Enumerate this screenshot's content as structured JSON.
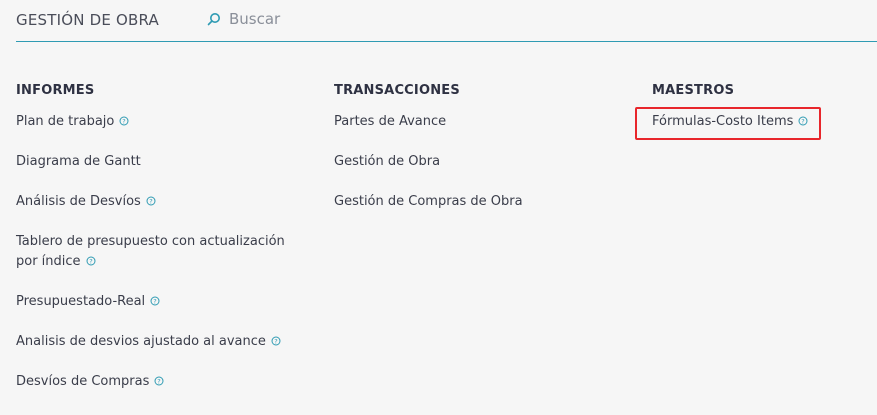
{
  "header": {
    "title": "GESTIÓN DE OBRA",
    "search_placeholder": "Buscar"
  },
  "sections": {
    "informes": {
      "title": "INFORMES",
      "items": [
        {
          "label": "Plan de trabajo",
          "help": true
        },
        {
          "label": "Diagrama de Gantt",
          "help": false
        },
        {
          "label": "Análisis de Desvíos",
          "help": true
        },
        {
          "label_line1": "Tablero de presupuesto con actualización",
          "label_line2": "por índice",
          "help": true
        },
        {
          "label": "Presupuestado-Real",
          "help": true
        },
        {
          "label": "Analisis de desvios ajustado al avance",
          "help": true
        },
        {
          "label": "Desvíos de Compras",
          "help": true
        }
      ]
    },
    "transacciones": {
      "title": "TRANSACCIONES",
      "items": [
        {
          "label": "Partes de Avance"
        },
        {
          "label": "Gestión de Obra"
        },
        {
          "label": "Gestión de Compras de Obra"
        }
      ]
    },
    "maestros": {
      "title": "MAESTROS",
      "items": [
        {
          "label": "Fórmulas-Costo Items",
          "help": true,
          "highlighted": true
        }
      ]
    }
  },
  "colors": {
    "accent": "#2f9bb3",
    "highlight_border": "#e8262b",
    "text": "#3a3d4a"
  },
  "icons": {
    "search": "search-icon",
    "help": "help-circle-icon"
  }
}
